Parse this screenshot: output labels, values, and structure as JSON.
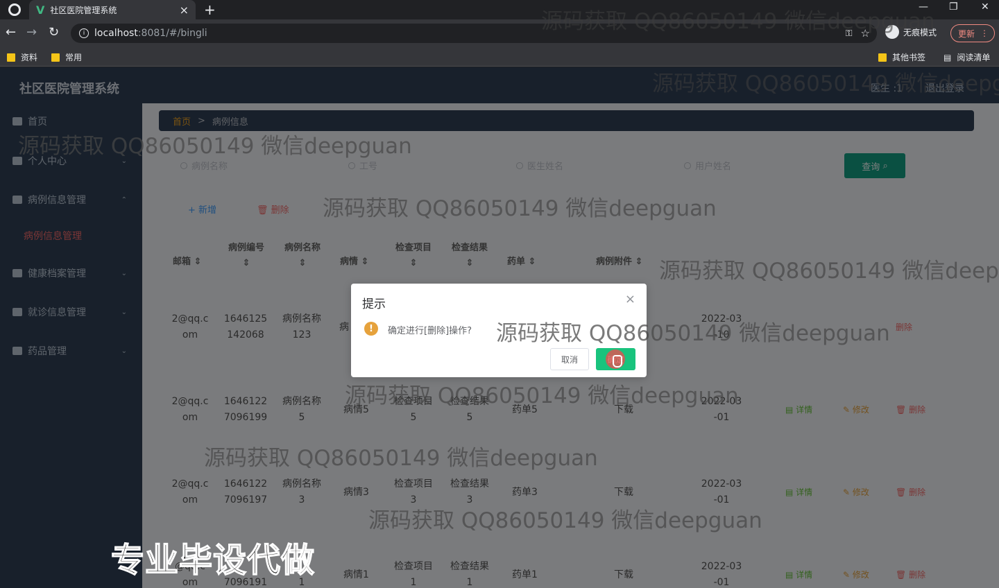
{
  "browser": {
    "tab_title": "社区医院管理系统",
    "url_host": "localhost",
    "url_path": ":8081/#/bingli",
    "incognito_label": "无痕模式",
    "update_label": "更新",
    "bookmarks": [
      "资料",
      "常用"
    ],
    "other_bookmarks": "其他书签",
    "reading_list": "阅读清单"
  },
  "app": {
    "title": "社区医院管理系统",
    "user_label": "医生 :1",
    "logout_label": "退出登录"
  },
  "sidebar": {
    "items": [
      {
        "label": "首页"
      },
      {
        "label": "个人中心"
      },
      {
        "label": "病例信息管理"
      },
      {
        "label": "病例信息管理"
      },
      {
        "label": "健康档案管理"
      },
      {
        "label": "就诊信息管理"
      },
      {
        "label": "药品管理"
      }
    ]
  },
  "breadcrumb": {
    "home": "首页",
    "sep": ">",
    "current": "病例信息"
  },
  "search": {
    "fields": [
      "病例名称",
      "工号",
      "医生姓名",
      "用户姓名"
    ],
    "query_label": "查询"
  },
  "toolbar": {
    "add_label": "+ 新增",
    "delete_label": "删除"
  },
  "table": {
    "headers": [
      "邮箱",
      "病例编号",
      "病例名称",
      "病情",
      "检查项目",
      "检查结果",
      "药单",
      "病例附件"
    ],
    "rows": [
      {
        "email": [
          "2@qq.c",
          "om"
        ],
        "code": [
          "1646125",
          "142068"
        ],
        "name": [
          "病例名称",
          "123"
        ],
        "cond": "病",
        "item": "",
        "result": "",
        "drug": "",
        "attach": "",
        "date": [
          "2022-03",
          "-10"
        ]
      },
      {
        "email": [
          "2@qq.c",
          "om"
        ],
        "code": [
          "1646122",
          "7096199"
        ],
        "name": [
          "病例名称",
          "5"
        ],
        "cond": "病情5",
        "item": [
          "检查项目",
          "5"
        ],
        "result": [
          "检查结果",
          "5"
        ],
        "drug": "药单5",
        "attach": "下载",
        "date": [
          "2022-03",
          "-01"
        ]
      },
      {
        "email": [
          "2@qq.c",
          "om"
        ],
        "code": [
          "1646122",
          "7096197"
        ],
        "name": [
          "病例名称",
          "3"
        ],
        "cond": "病情3",
        "item": [
          "检查项目",
          "3"
        ],
        "result": [
          "检查结果",
          "3"
        ],
        "drug": "药单3",
        "attach": "下载",
        "date": [
          "2022-03",
          "-01"
        ]
      },
      {
        "email": [
          "@qq.c",
          "om"
        ],
        "code": [
          "",
          "7096191"
        ],
        "name": [
          "",
          "1"
        ],
        "cond": "病情1",
        "item": [
          "检查项目",
          "1"
        ],
        "result": [
          "检查结果",
          "1"
        ],
        "drug": "药单1",
        "attach": "下载",
        "date": [
          "2022-03",
          "-01"
        ]
      }
    ],
    "actions": {
      "detail": "详情",
      "edit": "修改",
      "delete": "删除"
    }
  },
  "dialog": {
    "title": "提示",
    "message": "确定进行[删除]操作?",
    "cancel_label": "取消",
    "confirm_label": "确定"
  },
  "watermark": "源码获取 QQ86050149 微信deepguan",
  "promo": "专业毕设代做",
  "colors": {
    "sidebar": "#304156",
    "confirm": "#19c37d",
    "warn": "#e6a23c",
    "danger": "#f56c6c"
  }
}
